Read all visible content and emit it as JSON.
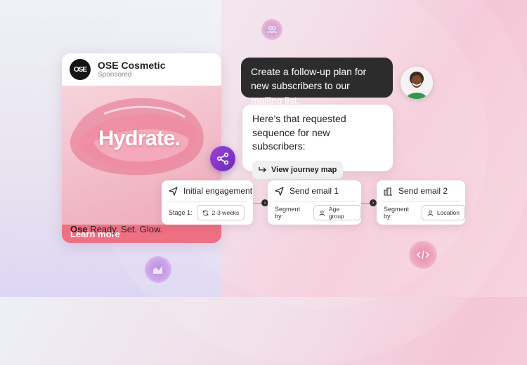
{
  "ad_card": {
    "logo_text": "OSE",
    "brand_name": "OSE Cosmetic",
    "sponsored_label": "Sponsored",
    "image_headline": "Hydrate.",
    "cta_label": "Learn more",
    "tagline_brand": "Ose",
    "tagline_text": " Ready. Set. Glow."
  },
  "chat": {
    "user_message": "Create a follow-up plan for new subscribers to our mailing list.",
    "assistant_message": "Here’s that requested sequence for new subscribers:",
    "journey_button_label": "View journey map"
  },
  "journey": {
    "steps": [
      {
        "title": "Initial engagement",
        "icon": "send-icon",
        "field_label": "Stage 1:",
        "chip": "2-3 weeks",
        "chip_icon": "refresh-icon"
      },
      {
        "title": "Send email 1",
        "icon": "send-icon",
        "field_label": "Segment by:",
        "chip": "Age group",
        "chip_icon": "user-icon"
      },
      {
        "title": "Send email 2",
        "icon": "building-icon",
        "field_label": "Segment by:",
        "chip": "Location",
        "chip_icon": "user-icon"
      }
    ]
  },
  "colors": {
    "accent_purple": "#7a32c4",
    "cta_pink": "#ef6f83",
    "dark_bubble": "#2c2c2c"
  }
}
